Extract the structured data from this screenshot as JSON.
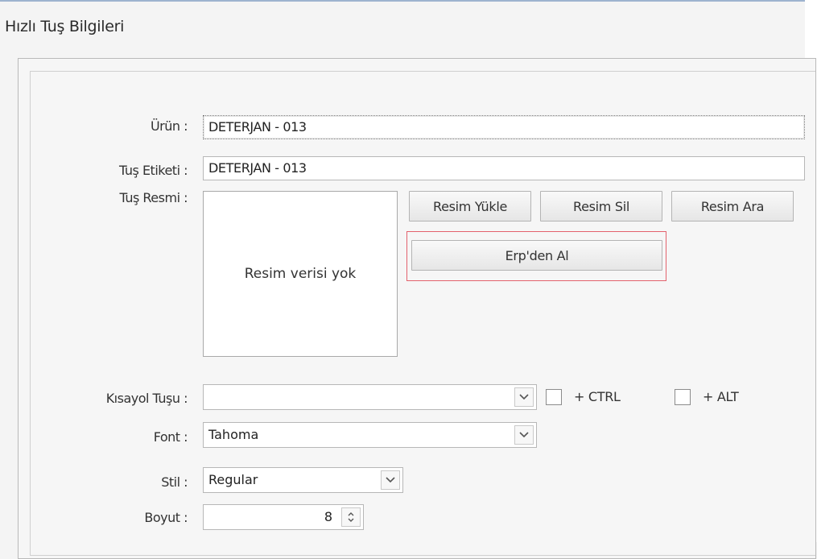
{
  "window": {
    "title": "Hızlı Tuş Bilgileri"
  },
  "form": {
    "urun": {
      "label": "Ürün :",
      "value": "DETERJAN - 013"
    },
    "tus_etiketi": {
      "label": "Tuş Etiketi :",
      "value": "DETERJAN - 013"
    },
    "tus_resmi": {
      "label": "Tuş Resmi :",
      "placeholder_text": "Resim verisi yok"
    },
    "buttons": {
      "resim_yukle": "Resim Yükle",
      "resim_sil": "Resim Sil",
      "resim_ara": "Resim Ara",
      "erpden_al": "Erp'den Al"
    },
    "highlight_color": "#e3626d",
    "kisayol_tusu": {
      "label": "Kısayol Tuşu :",
      "value": "",
      "ctrl_label": "+ CTRL",
      "alt_label": "+ ALT",
      "ctrl_checked": false,
      "alt_checked": false
    },
    "font": {
      "label": "Font :",
      "value": "Tahoma"
    },
    "stil": {
      "label": "Stil :",
      "value": "Regular"
    },
    "boyut": {
      "label": "Boyut :",
      "value": "8"
    }
  },
  "icons": {
    "dropdown": "chevron-down-icon",
    "spinner": "spinner-arrows-icon"
  }
}
